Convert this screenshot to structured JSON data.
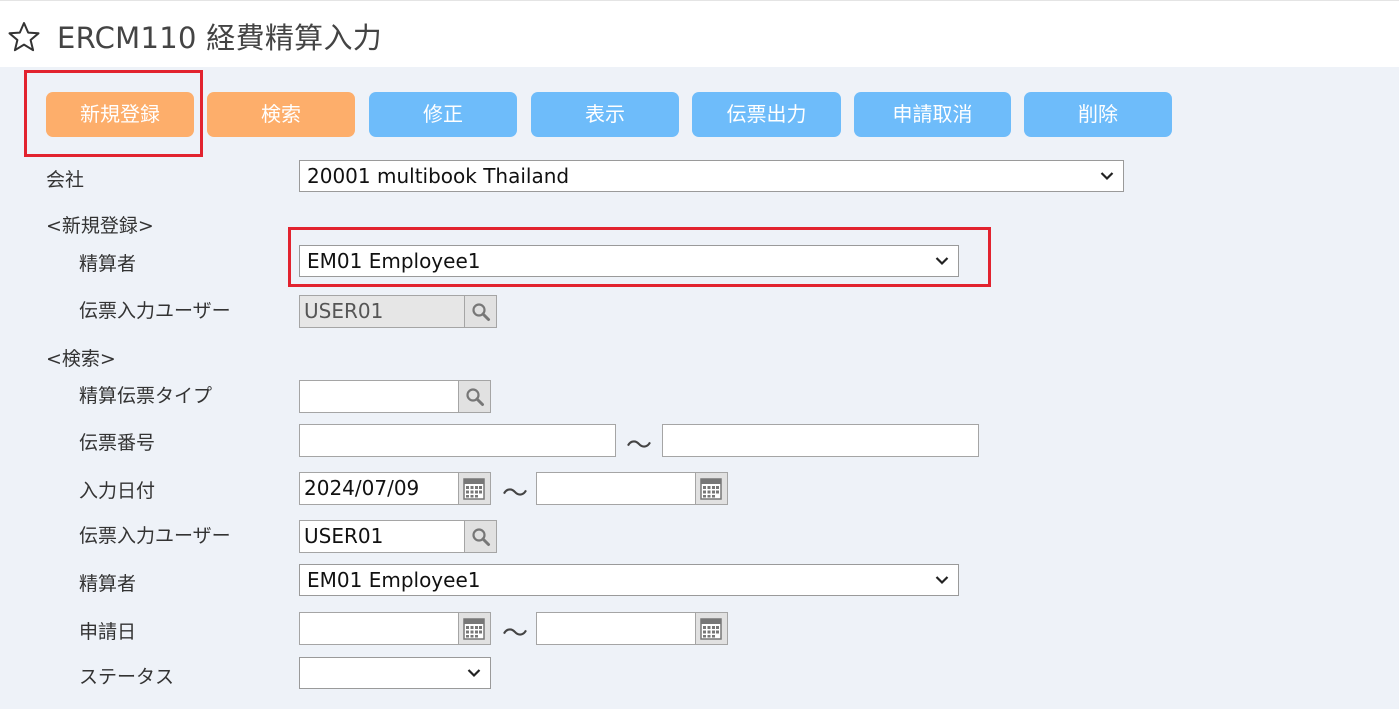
{
  "header": {
    "title": "ERCM110 経費精算入力",
    "star_icon": "star-outline-icon"
  },
  "toolbar": {
    "new_label": "新規登録",
    "search_label": "検索",
    "edit_label": "修正",
    "view_label": "表示",
    "print_label": "伝票出力",
    "cancel_request_label": "申請取消",
    "delete_label": "削除"
  },
  "colors": {
    "primary_button": "#fdae6b",
    "secondary_button": "#6ebcfa",
    "highlight": "#e2232f",
    "background": "#eef2f8"
  },
  "form": {
    "company_label": "会社",
    "company_value": "20001 multibook Thailand",
    "new_section_label": "<新規登録>",
    "new_payee_label": "精算者",
    "new_payee_value": "EM01 Employee1",
    "new_entry_user_label": "伝票入力ユーザー",
    "new_entry_user_value": "USER01",
    "search_section_label": "<検索>",
    "slip_type_label": "精算伝票タイプ",
    "slip_type_value": "",
    "slip_no_label": "伝票番号",
    "slip_no_from": "",
    "slip_no_to": "",
    "input_date_label": "入力日付",
    "input_date_from": "2024/07/09",
    "input_date_to": "",
    "entry_user_label": "伝票入力ユーザー",
    "entry_user_value": "USER01",
    "payee_label": "精算者",
    "payee_value": "EM01 Employee1",
    "apply_date_label": "申請日",
    "apply_date_from": "",
    "apply_date_to": "",
    "status_label": "ステータス",
    "status_value": "",
    "range_separator": "～"
  }
}
